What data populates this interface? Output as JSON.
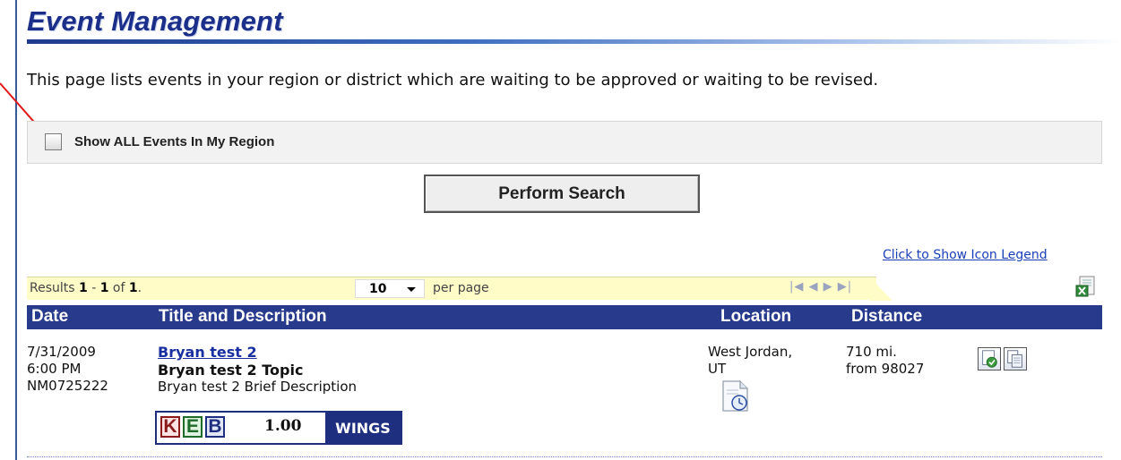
{
  "header": {
    "title": "Event Management"
  },
  "intro_text": "This page lists events in your region or district which are waiting to be approved or waiting to be revised.",
  "filter": {
    "checkbox_label": "Show ALL Events In My Region",
    "checked": false
  },
  "search_button": "Perform Search",
  "legend_link": "Click to Show Icon Legend",
  "results": {
    "prefix": "Results ",
    "range_start": "1",
    "dash": " - ",
    "range_end": "1",
    "of": " of ",
    "total": "1",
    "period": ".",
    "per_page_value": "10",
    "per_page_label": "per page",
    "pager_symbols": "|◀ ◀ ▶ ▶|"
  },
  "table": {
    "columns": [
      "Date",
      "Title and Description",
      "Location",
      "Distance"
    ],
    "rows": [
      {
        "date": "7/31/2009",
        "time": "6:00 PM",
        "id": "NM0725222",
        "title": "Bryan test 2",
        "topic": "Bryan test 2 Topic",
        "description": "Bryan test 2 Brief Description",
        "credit_letters": [
          "K",
          "E",
          "B"
        ],
        "credit_hours": "1.00",
        "credit_program": "WINGS",
        "location_line1": "West Jordan,",
        "location_line2": "UT",
        "distance_line1": "710 mi.",
        "distance_line2": "from 98027"
      }
    ]
  },
  "colors": {
    "header_blue": "#1b2f8a",
    "table_header_bg": "#283a8c",
    "results_bar_bg": "#fffcc8",
    "link_blue": "#1a40b8",
    "arrow_red": "#e01818"
  },
  "icons": [
    "checkbox-icon",
    "excel-export-icon",
    "calendar-reminder-icon",
    "approve-icon",
    "copy-icon",
    "pager-first-icon",
    "pager-prev-icon",
    "pager-next-icon",
    "pager-last-icon",
    "dropdown-arrow-icon"
  ]
}
